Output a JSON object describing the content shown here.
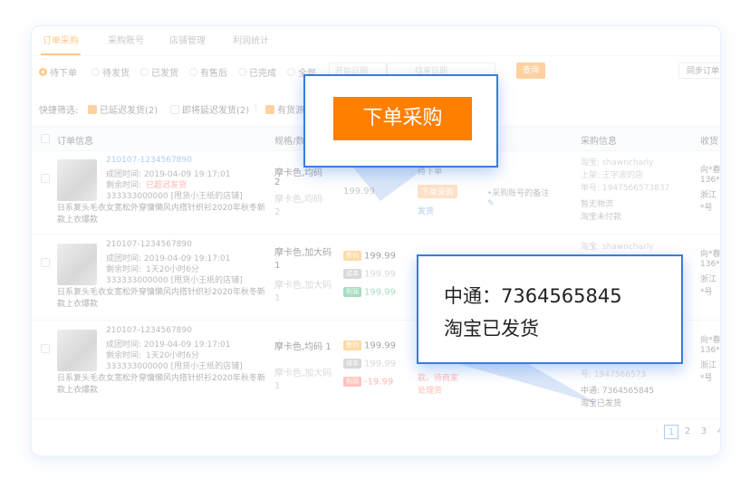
{
  "tabs": [
    "订单采购",
    "采购账号",
    "店铺管理",
    "利润统计"
  ],
  "filters": {
    "radios": [
      "待下单",
      "待发货",
      "已发货",
      "有售后",
      "已完成",
      "全部"
    ],
    "start_date": "开始日期",
    "end_date": "结束日期",
    "query": "查询",
    "sync": "同步订单"
  },
  "quick": {
    "label": "快捷筛选:",
    "items": [
      "已延迟发货(2)",
      "即将延迟发货(2)",
      "有货源"
    ],
    "separator": "|"
  },
  "headers": [
    "订单信息",
    "规格/数",
    "注",
    "采购信息",
    "收货"
  ],
  "orders": [
    {
      "id": "210107-1234567890",
      "created": "成团时间: 2019-04-09 19:17:01",
      "remaining_label": "剩余时间:",
      "remaining": "已超迟发货",
      "shop": "333333000000 [甩货小王纸的店铺]",
      "title": "日系复头毛衣女宽松外穿慵懒风内搭针织衫2020年秋冬新款上衣爆款",
      "spec1": "摩卡色,均码",
      "spec1b": "2",
      "spec2": "摩卡色,均码",
      "spec2b": "2",
      "price": "199.99",
      "status": "待下单",
      "status_btn": "下单采购",
      "status_link": "发货",
      "note": "•采购账号的备注",
      "note_icon": "✎",
      "info": [
        "淘宝: shawncharly",
        "上架: 王宇波的店",
        "单号: 1947566573837",
        "暂无物流",
        "淘宝未付款"
      ],
      "recv": [
        "向*春",
        "136*",
        "浙江",
        "*号"
      ]
    },
    {
      "id": "210107-1234567890",
      "created": "成团时间: 2019-04-09 19:17:01",
      "remaining_label": "剩余时间:",
      "remaining": "1天20小时6分",
      "shop": "333333000000 [甩货小王纸的店铺]",
      "title": "日系复头毛衣女宽松外穿慵懒风内搭针织衫2020年秋冬新款上衣爆款",
      "spec1": "摩卡色,加大码 1",
      "spec2": "摩卡色,加大码 1",
      "badges": [
        "售价",
        "成本",
        "利润"
      ],
      "prices": [
        "199.99",
        "199.99",
        "199.99"
      ],
      "info": [
        "淘宝: shawncharly"
      ],
      "recv": [
        "向*春",
        "136*",
        "浙江",
        "*号"
      ]
    },
    {
      "id": "210107-1234567890",
      "created": "成团时间: 2019-04-09 19:17:01",
      "remaining_label": "剩余时间:",
      "remaining": "1天20小时6分",
      "shop": "333333000000 [甩货小王纸的店铺]",
      "title": "日系复头毛衣女宽松外穿慵懒风内搭针织衫2020年秋冬新款上衣爆款",
      "spec1": "摩卡色,均码 1",
      "spec2": "摩卡色,加大码 1",
      "badges": [
        "售价",
        "成本",
        "利润"
      ],
      "prices": [
        "199.99",
        "199.99",
        "-19.99"
      ],
      "status_lines": [
        "款。待商家",
        "处理货"
      ],
      "info": [
        "号: 1947566573",
        "中通: 7364565845",
        "淘宝已发货"
      ],
      "recv": [
        "向*春",
        "136*",
        "浙江",
        "*号"
      ]
    }
  ],
  "pagination": {
    "prev": "‹",
    "pages": [
      "1",
      "2",
      "3",
      "4"
    ]
  },
  "popup_cta": {
    "label": "下单采购"
  },
  "popup_ship": {
    "line1": "中通：7364565845",
    "line2": "淘宝已发货"
  },
  "colors": {
    "accent": "#ff7f00",
    "link": "#4a90e2",
    "popup_border": "#3a7be0"
  }
}
